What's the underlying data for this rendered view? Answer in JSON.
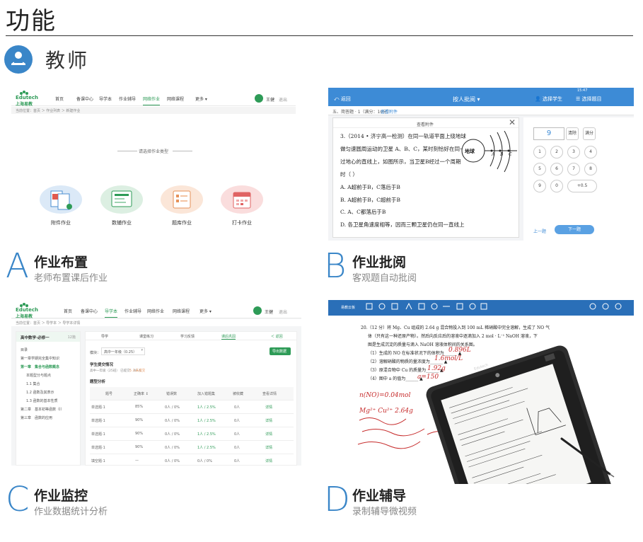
{
  "page": {
    "title": "功能",
    "role": "教师"
  },
  "features": [
    {
      "letter": "A",
      "title": "作业布置",
      "subtitle": "老师布置课后作业"
    },
    {
      "letter": "B",
      "title": "作业批阅",
      "subtitle": "客观题自动批阅"
    },
    {
      "letter": "C",
      "title": "作业监控",
      "subtitle": "作业数据统计分析"
    },
    {
      "letter": "D",
      "title": "作业辅导",
      "subtitle": "录制辅导微视频"
    }
  ],
  "screen_a": {
    "logo_en": "Edutech",
    "logo_cn": "上海易教",
    "nav": [
      "首页",
      "备课中心",
      "导学本",
      "作业辅导",
      "网络作业",
      "网络课程",
      "更多 ▾"
    ],
    "nav_active_index": 4,
    "user_name": "王健",
    "logout": "退出",
    "breadcrumb": "当前位置：首页 ＞ 作业列表 ＞ 新建作业",
    "section_heading": "请选择作业类型",
    "types": [
      "附件作业",
      "数辅作业",
      "题库作业",
      "打卡作业"
    ],
    "type_colors": [
      "#dbe9f7",
      "#dcefe2",
      "#fbe6d8",
      "#fadddd"
    ]
  },
  "screen_b": {
    "back": "返回",
    "center_title": "按人批阅 ▾",
    "right_1": "选择学生",
    "right_2": "选择题目",
    "time": "15:47",
    "sub_header": "五、简答题 · 1（满分：10分）",
    "sub_tag": "查看附件",
    "modal_title": "查看附件",
    "question_lines": [
      "3.（2014 • 济宁高一检测）在同一轨道平面上绕地球",
      "做匀速圆周运动的卫星 A、B、C，某时刻恰好在同一",
      "过地心的直线上，如图所示，当卫星B经过一个周期",
      "时（    ）",
      "A. A超前于B，C落后于B",
      "B. A超前于B，C超前于B",
      "C. A、C都落后于B",
      "D. 各卫星角速度相等，因而三颗卫星仍在同一直线上"
    ],
    "diagram_center": "地球",
    "diagram_labels": [
      "A",
      "B",
      "C"
    ],
    "score": "9",
    "keypad_top": [
      "清除",
      "满分"
    ],
    "keypad": [
      "1",
      "2",
      "3",
      "4",
      "5",
      "6",
      "7",
      "8",
      "9",
      "0",
      "+0.5"
    ],
    "prev": "上一题",
    "next": "下一题"
  },
  "screen_c": {
    "logo_en": "Edutech",
    "logo_cn": "上海易教",
    "nav": [
      "首页",
      "备课中心",
      "导学本",
      "作业辅导",
      "网络作业",
      "网络课程",
      "更多 ▾"
    ],
    "nav_active_index": 2,
    "user_name": "王健",
    "logout": "退出",
    "breadcrumb": "当前位置：首页 ＞ 导学本 ＞ 导学本详情",
    "book_title": "高中数学·必修一",
    "book_count": "12篇",
    "side_items": [
      "目录",
      "第一章学期完全集中知识",
      "第一章　集合与函数概念",
      "本题型分与题点",
      "1.1 集合",
      "1.2 函数及其表示",
      "1.3 函数的基本性质",
      "第二章　基本初等函数（Ⅰ）",
      "第三章　函数的应用"
    ],
    "tabs": [
      "导学",
      "课堂练习",
      "学习反馈",
      "课后巩固",
      "＜ 返回"
    ],
    "tab_active_index": 3,
    "section_label": "模块：",
    "section_value": "高中一年级（0.25）",
    "export_btn": "导出数据",
    "subhead": "学生提交情况",
    "submit_line": "高中一年级（25班）  已提交：30 人",
    "submit_link": "5 人未提交",
    "analysis": "题型分析",
    "columns": [
      "题号",
      "正确率 ↕",
      "错误数",
      "加入错题集",
      "被收藏",
      "查看详情"
    ],
    "rows": [
      {
        "no": "1",
        "type": "单选题·1",
        "rate": "85%",
        "wrong": "0人 / 0%",
        "err": "1人 / 2.5%",
        "fav": "0人",
        "detail": "详情"
      },
      {
        "no": "2",
        "type": "单选题·1",
        "rate": "90%",
        "wrong": "0人 / 0%",
        "err": "1人 / 2.5%",
        "fav": "0人",
        "detail": "详情"
      },
      {
        "no": "3",
        "type": "单选题·1",
        "rate": "90%",
        "wrong": "0人 / 0%",
        "err": "1人 / 2.5%",
        "fav": "0人",
        "detail": "详情"
      },
      {
        "no": "4",
        "type": "单选题·1",
        "rate": "90%",
        "wrong": "0人 / 0%",
        "err": "1人 / 2.5%",
        "fav": "0人",
        "detail": "详情"
      },
      {
        "no": "5",
        "type": "填空题·1",
        "rate": "—",
        "wrong": "0人 / 0%",
        "err": "0人 / 0%",
        "fav": "0人",
        "detail": "详情"
      }
    ]
  },
  "screen_d": {
    "app_name": "易教云板",
    "lines": [
      "20.（12 分）将 Mg、Cu 组成的 2.64 g 混合物投入到 100 mL 稀硝酸中完全溶解，生成了 NO 气",
      "体（只有这一种还原产物）。然后向反应后的溶液中逐滴加入 2 mol · L⁻¹ NaOH 溶液，下",
      "图是生成沉淀的质量与滴入 NaOH 溶液体积间的关系图。",
      "（1）生成的 NO 在标准状况下的体积为______ ▲",
      "（2）溶解硝酸的物质的量浓度为______ ▲",
      "（3）原混合物中 Cu 的质量为______ ▲",
      "（4）图中 a 的值为______ ▲"
    ],
    "ink": [
      "0.896L",
      "1.6mol/L",
      "1.92g",
      "a=150",
      "n(NO)=0.04mol",
      "Mg²⁺ Cu²⁺ 2.64g"
    ],
    "tablet_brand": "Edutech"
  }
}
